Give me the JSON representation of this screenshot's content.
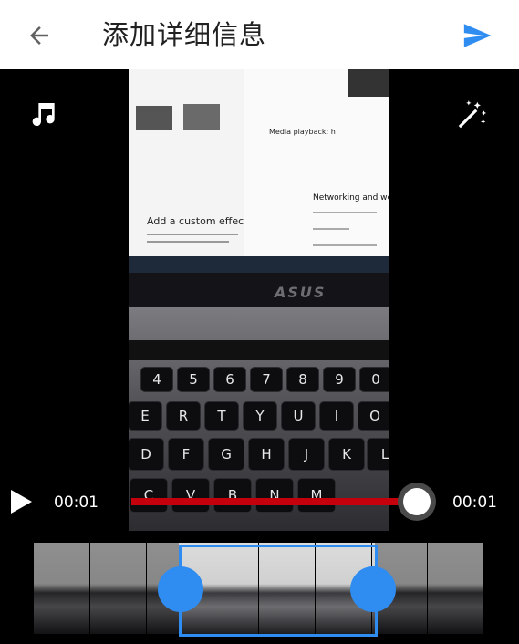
{
  "header": {
    "title": "添加详细信息"
  },
  "icons": {
    "back": "arrow-back-icon",
    "send": "send-icon",
    "music": "music-note-icon",
    "effects": "magic-wand-icon",
    "play": "play-icon"
  },
  "player": {
    "current_time": "00:01",
    "duration": "00:01",
    "progress": 1.0
  },
  "video_content": {
    "doc_heading_left": "Add a custom effect t",
    "doc_bullet_right": "Media playback: h",
    "doc_heading_right": "Networking and web",
    "laptop_brand": "ASUS",
    "key_rows": [
      [
        "4",
        "5",
        "6",
        "7",
        "8",
        "9",
        "0"
      ],
      [
        "E",
        "R",
        "T",
        "Y",
        "U",
        "I",
        "O"
      ],
      [
        "D",
        "F",
        "G",
        "H",
        "J",
        "K",
        "L"
      ],
      [
        "C",
        "V",
        "B",
        "N",
        "M"
      ]
    ]
  },
  "colors": {
    "accent": "#2f8cf0",
    "progress": "#c4000c",
    "header_bg": "#ffffff",
    "title_text": "#212121"
  },
  "trimmer": {
    "frame_count": 8
  }
}
